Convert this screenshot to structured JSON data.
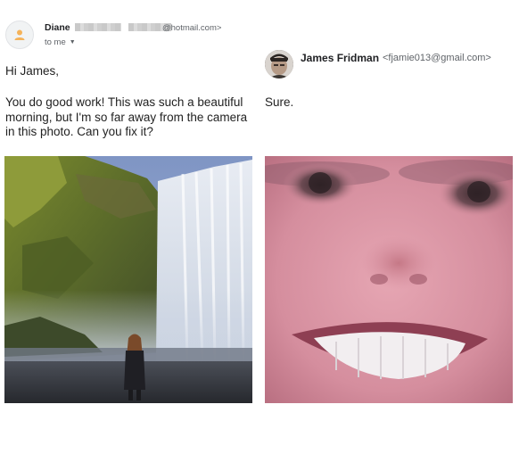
{
  "original_email": {
    "sender_name": "Diane",
    "sender_domain": "@hotmail.com>",
    "recipient_line": "to me",
    "greeting": "Hi James,",
    "body": "You do good work! This was such a beautiful morning, but I'm so far away from the camera in this photo. Can you fix it?",
    "attachment_icon": "person-avatar-icon"
  },
  "reply_email": {
    "sender_name": "James Fridman",
    "sender_email": "<fjamie013@gmail.com>",
    "body": "Sure."
  },
  "colors": {
    "text": "#222222",
    "secondary_text": "#5f6368",
    "avatar_bg": "#f1f3f4",
    "avatar_icon": "#f5b35a"
  }
}
